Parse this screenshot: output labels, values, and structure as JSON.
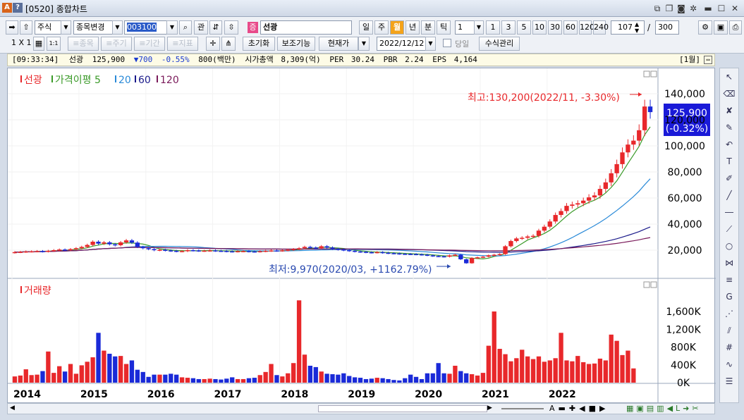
{
  "window": {
    "app_icon": "A",
    "help_icon": "?",
    "title": "[0520] 종합차트"
  },
  "toolbar": {
    "market": "주식",
    "change_label": "종목변경",
    "code": "003100",
    "gwan": "관",
    "stock_badge": "증",
    "stock_name": "선광",
    "periods": [
      "일",
      "주",
      "월",
      "년",
      "분",
      "틱"
    ],
    "selected_period": "월",
    "unit": "1",
    "quick_units": [
      "1",
      "3",
      "5",
      "10",
      "30",
      "60",
      "120",
      "240"
    ],
    "count": "107",
    "total": "300",
    "layout": "1 X 1",
    "sub_buttons": [
      "≡종목",
      "≡주기",
      "≡기간",
      "≡지표"
    ],
    "reset": "초기화",
    "aux": "보조기능",
    "price_type": "현재가",
    "date": "2022/12/12",
    "today_label": "당일",
    "formula": "수식관리"
  },
  "infobar": {
    "time": "[09:33:34]",
    "name": "선광",
    "price": "125,900",
    "change": "▼700",
    "pct": "-0.55%",
    "volume": "800(백만)",
    "mcap_label": "시가총액",
    "mcap": "8,309(억)",
    "per_label": "PER",
    "per": "30.24",
    "pbr_label": "PBR",
    "pbr": "2.24",
    "eps_label": "EPS",
    "eps": "4,164",
    "period_tag": "[1월]"
  },
  "price_pane": {
    "legend": [
      "선광",
      "가격이평 5",
      "20",
      "60",
      "120"
    ],
    "legend_colors": [
      "#e8282b",
      "#3a9a28",
      "#2a8ad8",
      "#1a1a8a",
      "#7a1a5a"
    ],
    "high_note": "최고:130,200(2022/11, -3.30%)",
    "low_note": "최저:9,970(2020/03, +1162.79%)",
    "current_price": "125,900",
    "current_pct": "(-0.32%)",
    "y_ticks": [
      "140,000",
      "120,000",
      "100,000",
      "80,000",
      "60,000",
      "40,000",
      "20,000"
    ]
  },
  "volume_pane": {
    "legend": "거래량",
    "y_ticks": [
      "1,600K",
      "1,200K",
      "800K",
      "400K",
      "0K"
    ]
  },
  "x_axis": [
    "2014",
    "2015",
    "2016",
    "2017",
    "2018",
    "2019",
    "2020",
    "2021",
    "2022"
  ],
  "chart_data": {
    "type": "bar",
    "title": "",
    "x_range": [
      "2014/01",
      "2022/12"
    ],
    "price_ylim": [
      0,
      150000
    ],
    "volume_ylim": [
      0,
      1900000
    ],
    "monthly_close": [
      18500,
      18700,
      19000,
      19100,
      19300,
      19000,
      19500,
      20000,
      20500,
      20200,
      20800,
      21500,
      22500,
      24000,
      26500,
      25000,
      26000,
      24500,
      23800,
      26000,
      27500,
      25800,
      22500,
      21500,
      20800,
      20000,
      20300,
      19800,
      19500,
      19100,
      19300,
      20000,
      19800,
      19500,
      19600,
      19800,
      19500,
      19400,
      19100,
      19000,
      19200,
      19300,
      19000,
      18900,
      19200,
      19500,
      19800,
      19600,
      19900,
      20300,
      20800,
      21500,
      22500,
      22000,
      21500,
      23000,
      22000,
      21000,
      20500,
      20000,
      19500,
      19000,
      18700,
      18400,
      18200,
      18500,
      18000,
      17700,
      17500,
      17200,
      17100,
      17000,
      16800,
      16500,
      16000,
      15500,
      15300,
      15000,
      16000,
      16500,
      13000,
      9970,
      14000,
      14500,
      15000,
      16000,
      16500,
      17000,
      23000,
      27000,
      29000,
      29500,
      30500,
      31000,
      35000,
      38000,
      42000,
      47000,
      50000,
      54000,
      55000,
      56000,
      58000,
      60500,
      62000,
      67000,
      72000,
      79000,
      86000,
      95000,
      101000,
      104000,
      112000,
      130200,
      125900
    ],
    "monthly_volume_k": [
      140,
      160,
      300,
      170,
      180,
      260,
      700,
      220,
      370,
      250,
      420,
      200,
      390,
      470,
      570,
      1120,
      720,
      650,
      590,
      600,
      420,
      500,
      290,
      240,
      130,
      180,
      180,
      180,
      200,
      180,
      120,
      110,
      100,
      80,
      80,
      90,
      80,
      70,
      90,
      120,
      80,
      80,
      100,
      110,
      170,
      240,
      420,
      170,
      140,
      210,
      440,
      1900,
      630,
      380,
      350,
      250,
      200,
      190,
      180,
      210,
      150,
      120,
      110,
      80,
      90,
      110,
      100,
      80,
      60,
      50,
      100,
      180,
      130,
      80,
      210,
      210,
      440,
      210,
      200,
      380,
      260,
      210,
      190,
      160,
      220,
      830,
      1600,
      760,
      640,
      480,
      550,
      740,
      590,
      530,
      590,
      470,
      500,
      550,
      1120,
      500,
      480,
      600,
      460,
      420,
      430,
      540,
      500,
      1080,
      940,
      620,
      720,
      320
    ],
    "volume_colors_note": "red=up month, blue=down month"
  }
}
